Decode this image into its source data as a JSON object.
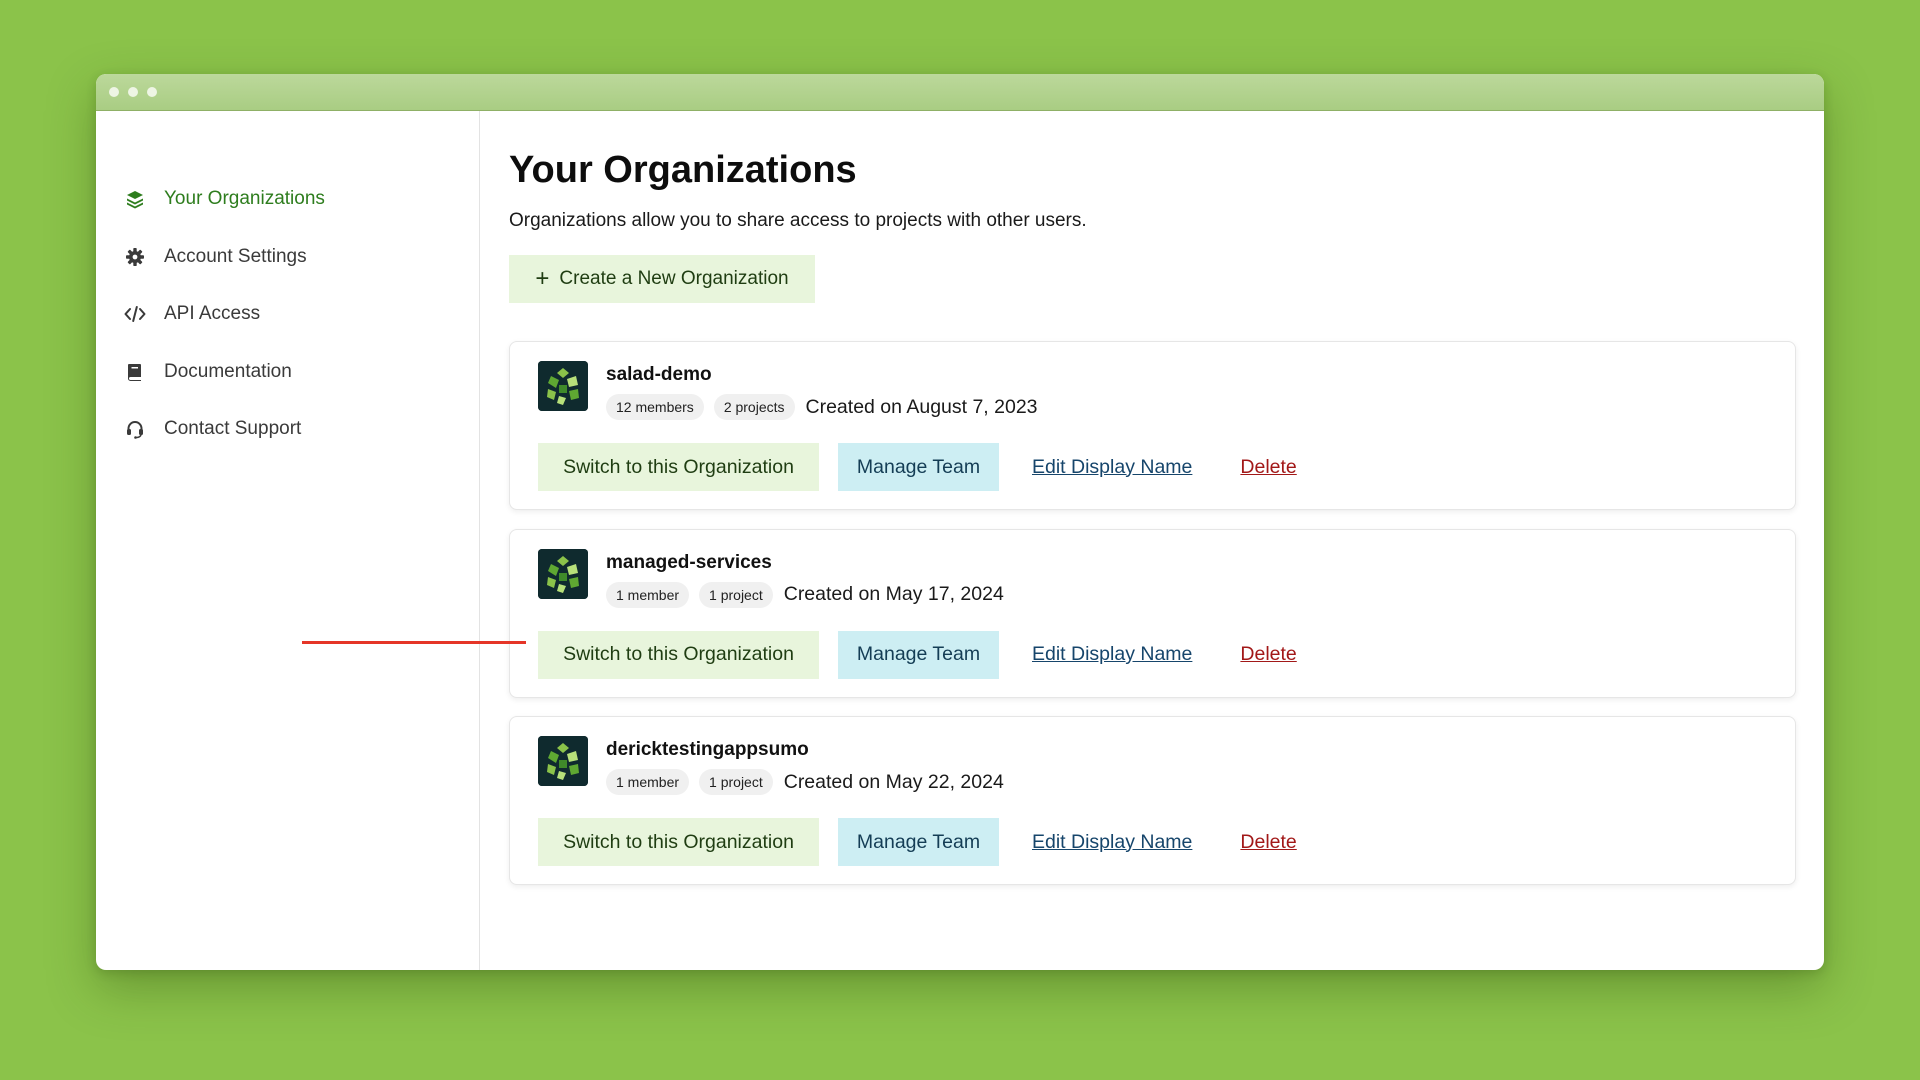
{
  "sidebar": {
    "items": [
      {
        "label": "Your Organizations",
        "icon": "layers-icon",
        "active": true
      },
      {
        "label": "Account Settings",
        "icon": "gear-icon",
        "active": false
      },
      {
        "label": "API Access",
        "icon": "code-icon",
        "active": false
      },
      {
        "label": "Documentation",
        "icon": "book-icon",
        "active": false
      },
      {
        "label": "Contact Support",
        "icon": "headset-icon",
        "active": false
      }
    ]
  },
  "main": {
    "title": "Your Organizations",
    "subtitle": "Organizations allow you to share access to projects with other users.",
    "create_button": "Create a New Organization"
  },
  "organizations": [
    {
      "name": "salad-demo",
      "members": "12 members",
      "projects": "2 projects",
      "created": "Created on August 7, 2023"
    },
    {
      "name": "managed-services",
      "members": "1 member",
      "projects": "1 project",
      "created": "Created on May 17, 2024"
    },
    {
      "name": "dericktestingappsumo",
      "members": "1 member",
      "projects": "1 project",
      "created": "Created on May 22, 2024"
    }
  ],
  "actions": {
    "switch_label": "Switch to this Organization",
    "manage_label": "Manage Team",
    "edit_label": "Edit Display Name",
    "delete_label": "Delete"
  },
  "colors": {
    "background": "#8bc34a",
    "accent_green": "#2e7d1e",
    "switch_bg": "#e8f5dc",
    "manage_bg": "#cdeef3",
    "delete_text": "#a21818",
    "annotation_line": "#e53528"
  }
}
